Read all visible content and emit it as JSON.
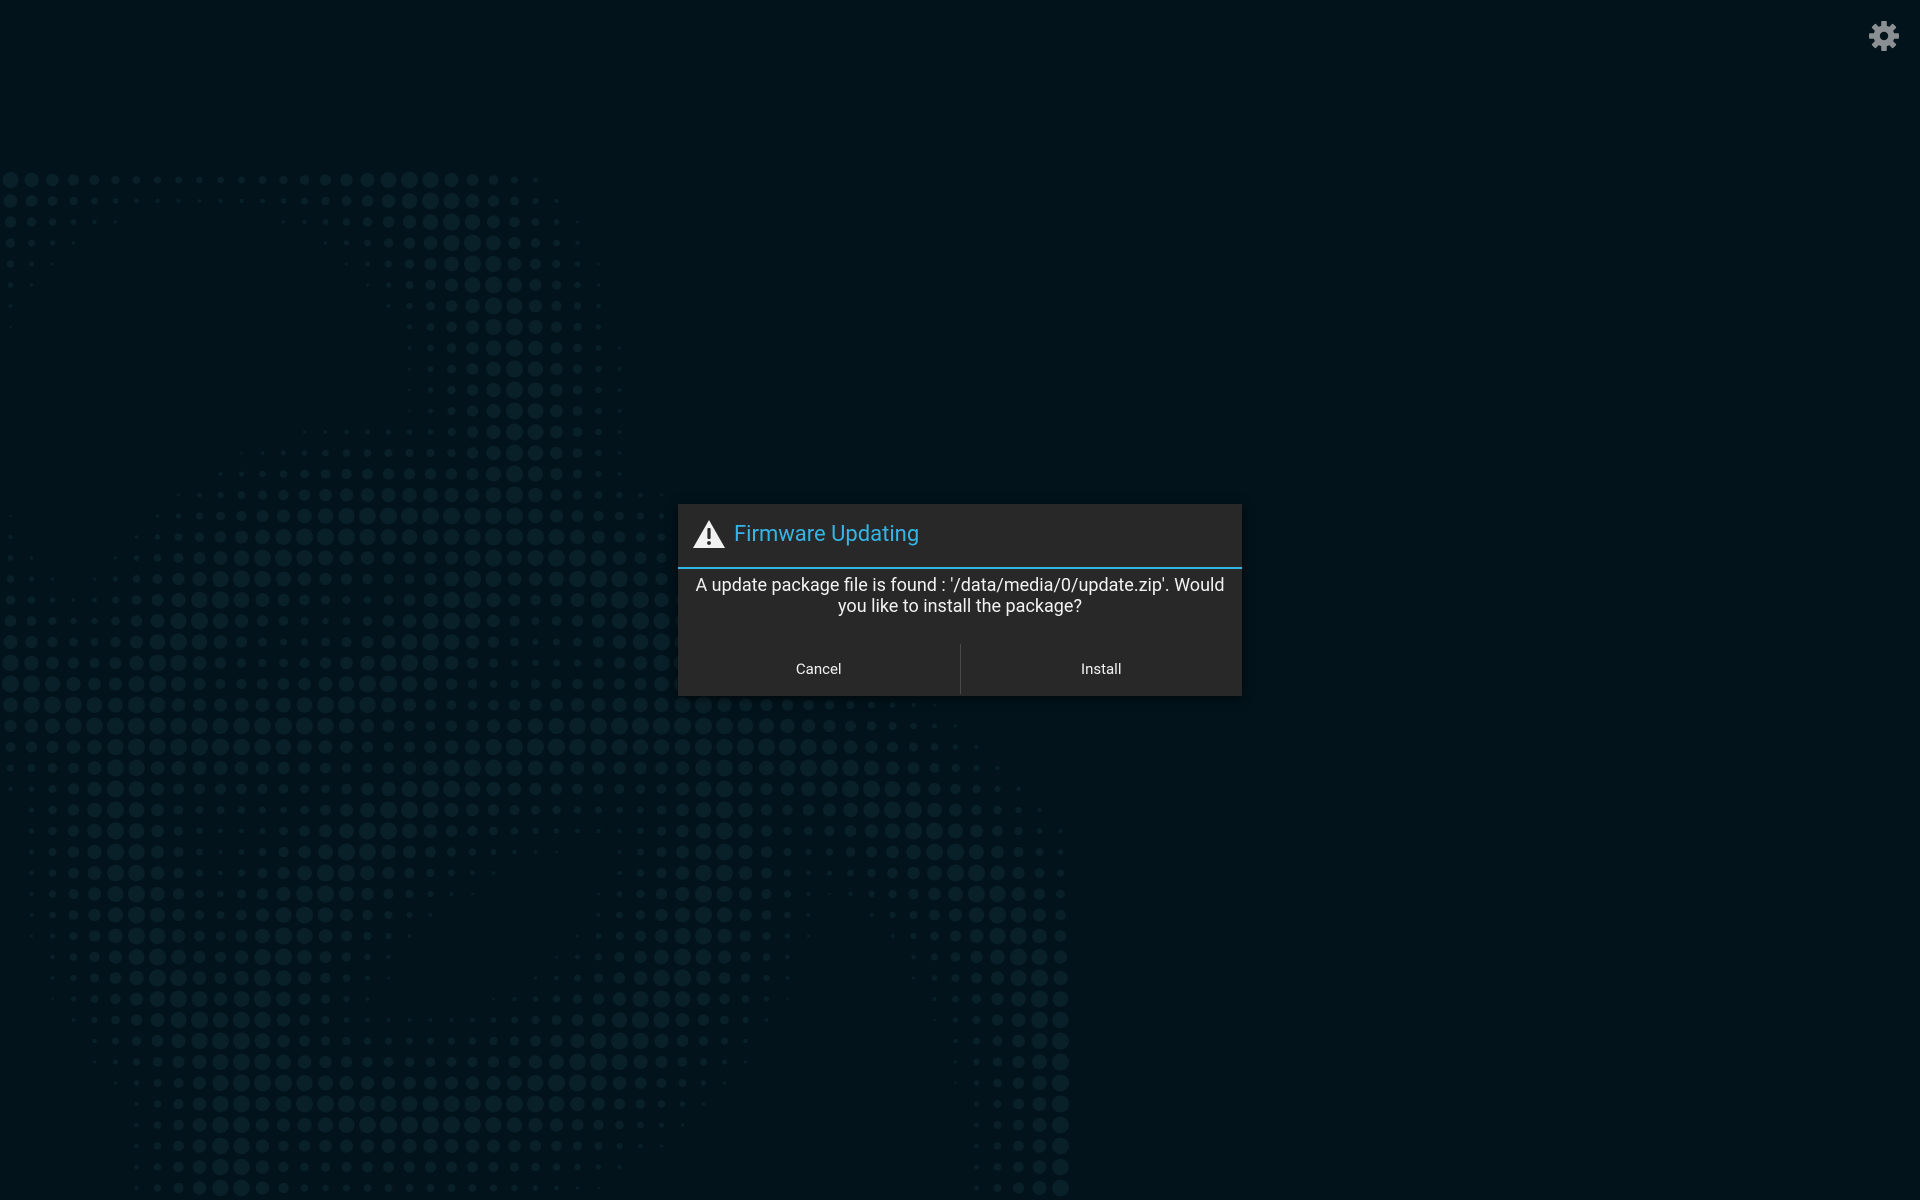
{
  "screen": {
    "background_color": "#02131b",
    "pattern_color": "#0a2029",
    "settings_icon": "gear-icon"
  },
  "dialog": {
    "icon": "warning-icon",
    "title": "Firmware Updating",
    "message": "A update package file is found : '/data/media/0/update.zip'. Would you like to install the package?",
    "accent_color": "#33b5e5",
    "buttons": {
      "cancel_label": "Cancel",
      "install_label": "Install"
    }
  }
}
